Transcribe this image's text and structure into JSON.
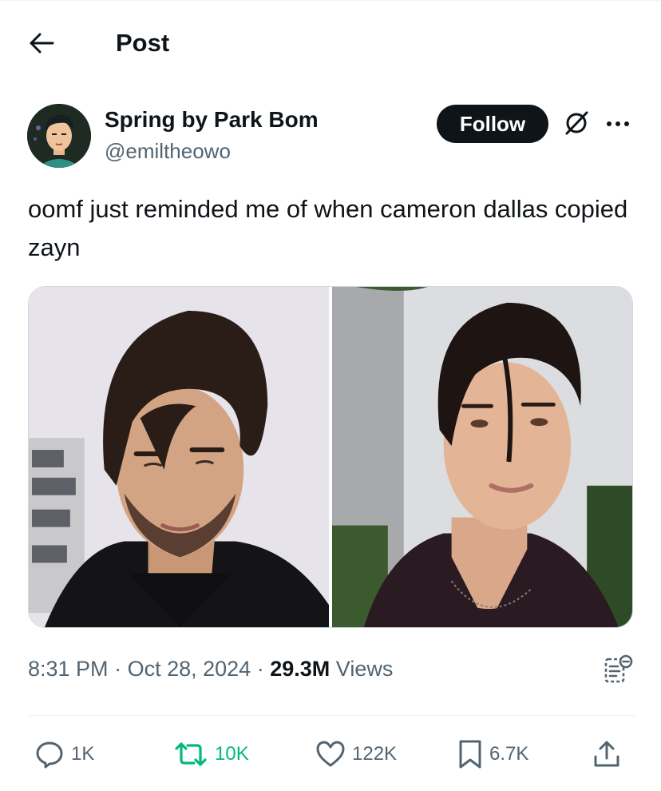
{
  "header": {
    "title": "Post"
  },
  "author": {
    "display_name": "Spring by Park Bom",
    "handle": "@emiltheowo",
    "follow_label": "Follow"
  },
  "tweet": {
    "text": "oomf just reminded me of when cameron dallas copied zayn"
  },
  "meta": {
    "time": "8:31 PM",
    "separator": "·",
    "date": "Oct 28, 2024",
    "views_count": "29.3M",
    "views_label": "Views"
  },
  "actions": {
    "replies": "1K",
    "reposts": "10K",
    "likes": "122K",
    "bookmarks": "6.7K"
  },
  "colors": {
    "text_primary": "#0f1419",
    "text_secondary": "#536471",
    "repost_green": "#00ba7c",
    "follow_bg": "#0f1419"
  },
  "icons": {
    "back": "arrow-left-icon",
    "grok": "grok-icon",
    "more": "more-icon",
    "analytics": "analytics-icon",
    "reply": "reply-icon",
    "repost": "repost-icon",
    "like": "heart-icon",
    "bookmark": "bookmark-icon",
    "share": "share-icon"
  }
}
